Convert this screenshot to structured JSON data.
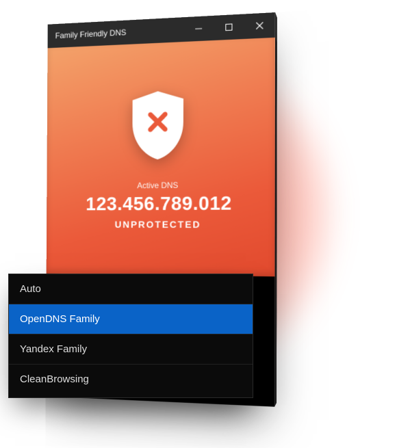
{
  "app": {
    "title": "Family Friendly DNS"
  },
  "hero": {
    "label": "Active DNS",
    "dns_value": "123.456.789.012",
    "status": "UNPROTECTED"
  },
  "dns_options": {
    "items": [
      {
        "label": "Auto",
        "selected": false
      },
      {
        "label": "OpenDNS Family",
        "selected": true
      },
      {
        "label": "Yandex Family",
        "selected": false
      },
      {
        "label": "CleanBrowsing",
        "selected": false
      }
    ]
  },
  "colors": {
    "accent_selected": "#0a63c7",
    "hero_gradient_start": "#f4a26a",
    "hero_gradient_end": "#e24a2e",
    "status_text": "#ffffff"
  }
}
